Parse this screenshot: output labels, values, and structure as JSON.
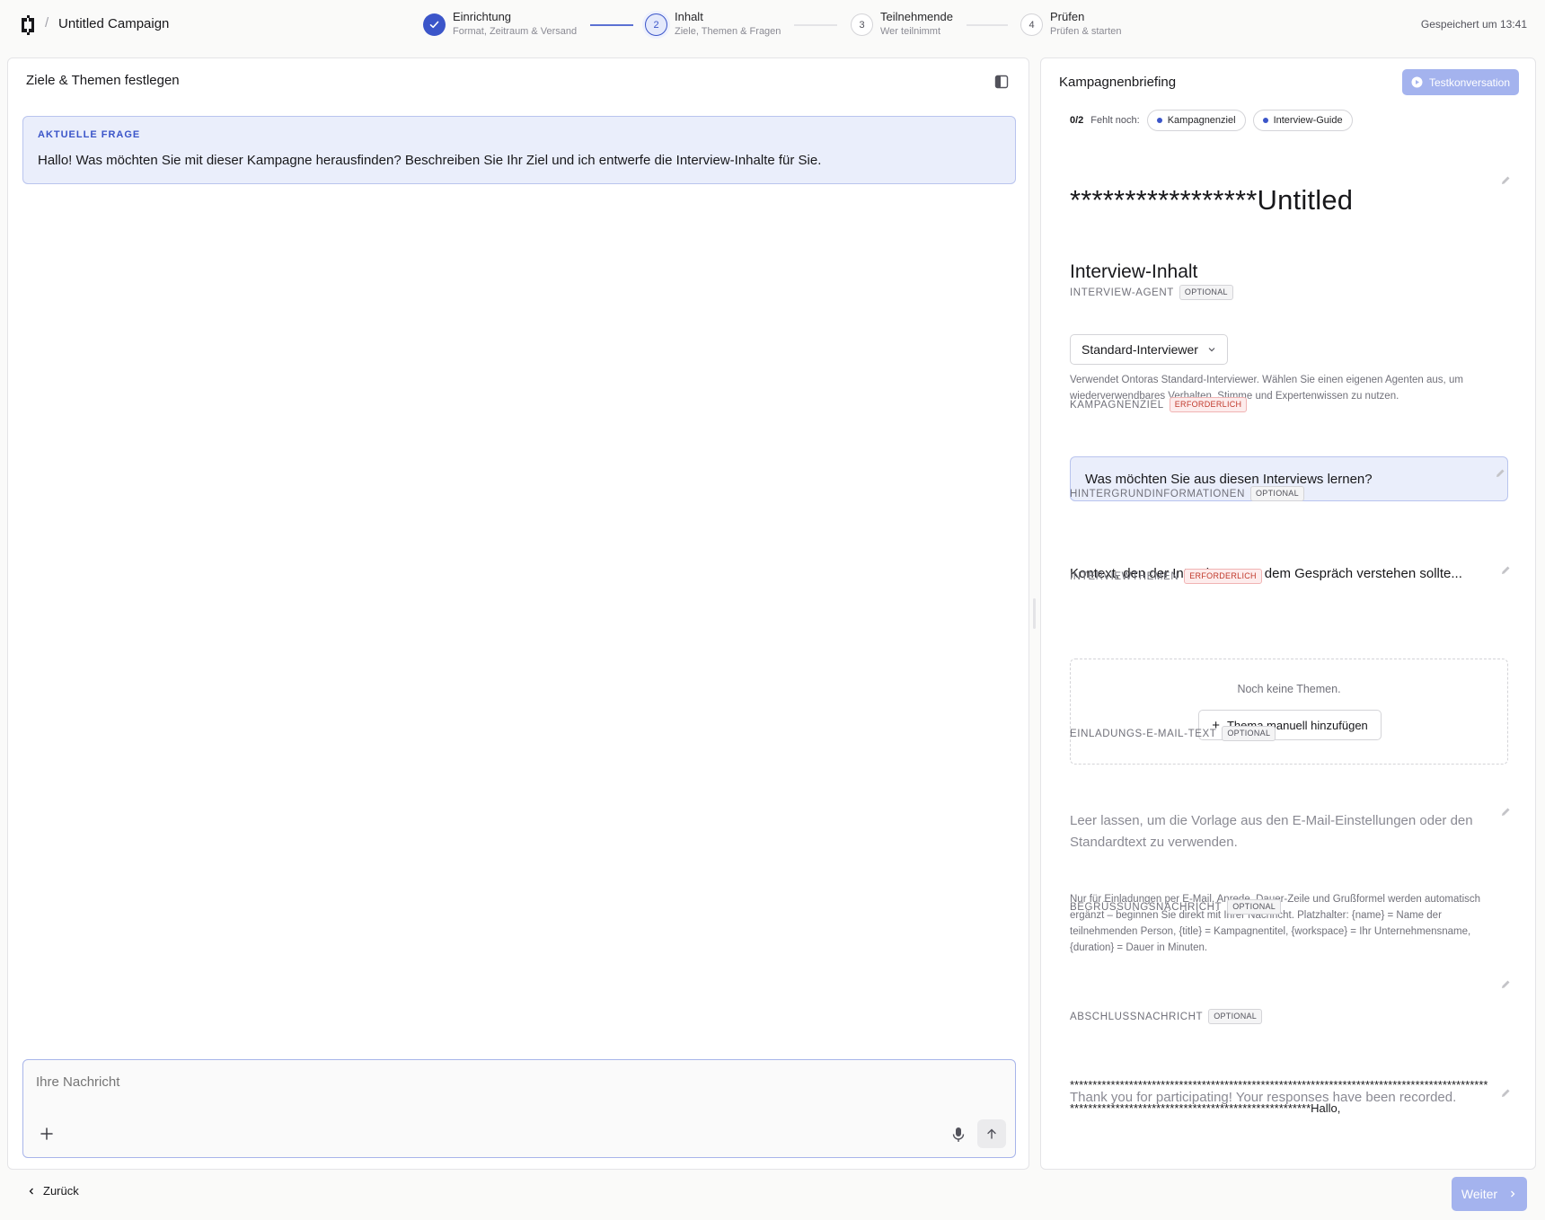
{
  "header": {
    "campaign_title": "Untitled Campaign",
    "separator": "/",
    "saved_text": "Gespeichert um 13:41"
  },
  "steps": [
    {
      "number": "1",
      "title": "Einrichtung",
      "subtitle": "Format, Zeitraum & Versand",
      "state": "done"
    },
    {
      "number": "2",
      "title": "Inhalt",
      "subtitle": "Ziele, Themen & Fragen",
      "state": "active"
    },
    {
      "number": "3",
      "title": "Teilnehmende",
      "subtitle": "Wer teilnimmt",
      "state": "todo"
    },
    {
      "number": "4",
      "title": "Prüfen",
      "subtitle": "Prüfen & starten",
      "state": "todo"
    }
  ],
  "left_panel": {
    "title": "Ziele & Themen festlegen",
    "question_label": "AKTUELLE FRAGE",
    "question_text": "Hallo! Was möchten Sie mit dieser Kampagne herausfinden? Beschreiben Sie Ihr Ziel und ich entwerfe die Interview-Inhalte für Sie.",
    "composer_placeholder": "Ihre Nachricht"
  },
  "right_panel": {
    "title": "Kampagnenbriefing",
    "test_button": "Testkonversation",
    "progress_count": "0/2",
    "progress_label": "Fehlt noch:",
    "missing_chips": [
      "Kampagnenziel",
      "Interview-Guide"
    ],
    "campaign_name": "*****************Untitled",
    "section_heading": "Interview-Inhalt",
    "agent": {
      "label": "INTERVIEW-AGENT",
      "badge": "OPTIONAL",
      "selected": "Standard-Interviewer",
      "help": "Verwendet Ontoras Standard-Interviewer. Wählen Sie einen eigenen Agenten aus, um wiederverwendbares Verhalten, Stimme und Expertenwissen zu nutzen."
    },
    "goal": {
      "label": "KAMPAGNENZIEL",
      "badge": "ERFORDERLICH",
      "placeholder": "Was möchten Sie aus diesen Interviews lernen?"
    },
    "background": {
      "label": "HINTERGRUNDINFORMATIONEN",
      "badge": "OPTIONAL",
      "text": "Kontext, den der Interviewer vor dem Gespräch verstehen sollte..."
    },
    "topics": {
      "label": "INTERVIEWTHEMEN",
      "badge": "ERFORDERLICH",
      "empty_text": "Noch keine Themen.",
      "add_button": "Thema manuell hinzufügen"
    },
    "invite": {
      "label": "EINLADUNGS-E-MAIL-TEXT",
      "badge": "OPTIONAL",
      "placeholder": "Leer lassen, um die Vorlage aus den E-Mail-Einstellungen oder den Standardtext zu verwenden.",
      "help": "Nur für Einladungen per E-Mail. Anrede, Dauer-Zeile und Grußformel werden automatisch ergänzt – beginnen Sie direkt mit Ihrer Nachricht. Platzhalter: {name} = Name der teilnehmenden Person, {title} = Kampagnentitel, {workspace} = Ihr Unternehmensname, {duration} = Dauer in Minuten."
    },
    "greeting": {
      "label": "BEGRÜSSUNGSNACHRICHT",
      "badge": "OPTIONAL",
      "text": "*************************************************************************************************************************************************Hallo,"
    },
    "closing": {
      "label": "ABSCHLUSSNACHRICHT",
      "badge": "OPTIONAL",
      "text": "Thank you for participating! Your responses have been recorded."
    }
  },
  "footer": {
    "back": "Zurück",
    "next": "Weiter"
  },
  "colors": {
    "accent": "#3b55c9",
    "accent_light": "#eaeefb",
    "button_disabled": "#a4b3ee",
    "required": "#c0392b"
  }
}
